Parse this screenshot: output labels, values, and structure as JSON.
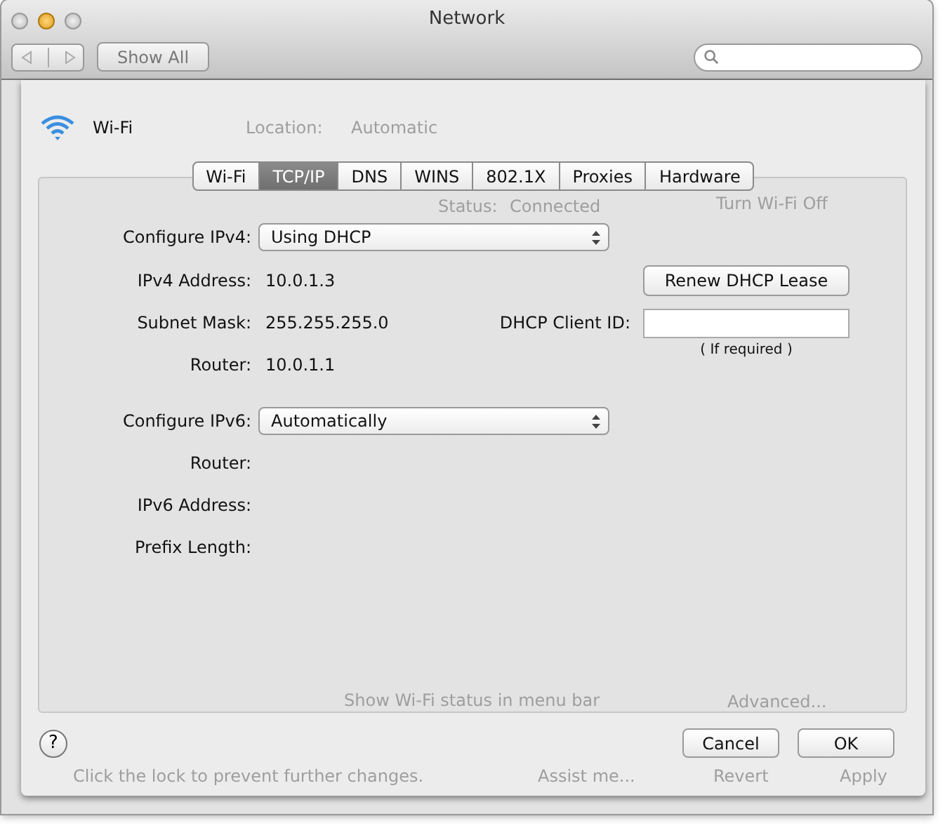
{
  "window": {
    "title": "Network",
    "toolbar": {
      "show_all": "Show All"
    }
  },
  "background_window": [
    {
      "text": "Location:"
    },
    {
      "text": "Automatic"
    },
    {
      "text": "Status:"
    },
    {
      "text": "Connected"
    },
    {
      "text": "Turn Wi-Fi Off"
    },
    {
      "text": "Show Wi-Fi status in menu bar"
    },
    {
      "text": "Advanced..."
    },
    {
      "text": "Click the lock to prevent further changes."
    },
    {
      "text": "Assist me..."
    },
    {
      "text": "Revert"
    },
    {
      "text": "Apply"
    }
  ],
  "sheet": {
    "service": "Wi-Fi",
    "tabs": [
      {
        "label": "Wi-Fi",
        "selected": false
      },
      {
        "label": "TCP/IP",
        "selected": true
      },
      {
        "label": "DNS",
        "selected": false
      },
      {
        "label": "WINS",
        "selected": false
      },
      {
        "label": "802.1X",
        "selected": false
      },
      {
        "label": "Proxies",
        "selected": false
      },
      {
        "label": "Hardware",
        "selected": false
      }
    ],
    "ipv4": {
      "configure_label": "Configure IPv4:",
      "configure_value": "Using DHCP",
      "rows": [
        {
          "label": "IPv4 Address:",
          "value": "10.0.1.3"
        },
        {
          "label": "Subnet Mask:",
          "value": "255.255.255.0"
        },
        {
          "label": "Router:",
          "value": "10.0.1.1"
        }
      ],
      "renew_button": "Renew DHCP Lease",
      "client_id_label": "DHCP Client ID:",
      "client_id_hint": "( If required )"
    },
    "ipv6": {
      "configure_label": "Configure IPv6:",
      "configure_value": "Automatically",
      "rows": [
        {
          "label": "Router:"
        },
        {
          "label": "IPv6 Address:"
        },
        {
          "label": "Prefix Length:"
        }
      ]
    },
    "help": "?",
    "buttons": [
      {
        "label": "Cancel"
      },
      {
        "label": "OK"
      }
    ]
  }
}
